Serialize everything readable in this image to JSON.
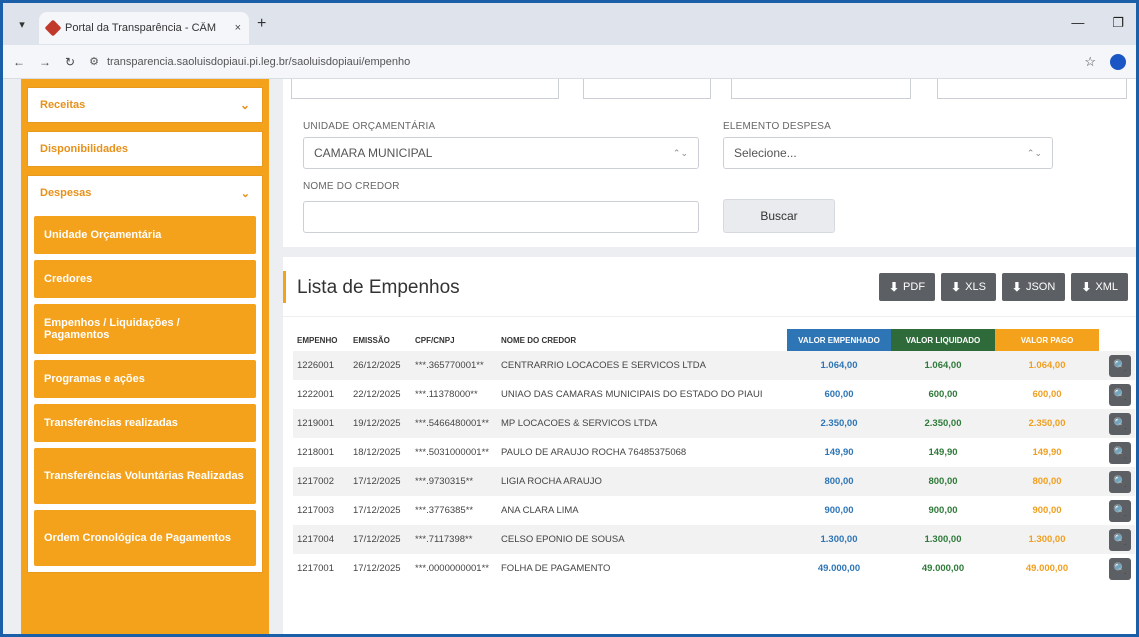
{
  "browser": {
    "tab_title": "Portal da Transparência - CÂM",
    "tab_close": "×",
    "new_tab": "+",
    "menu_glyph": "▾",
    "url": "transparencia.saoluisdopiaui.pi.leg.br/saoluisdopiaui/empenho",
    "url_prefix": "⚙",
    "back": "←",
    "forward": "→",
    "reload": "↻",
    "star": "☆",
    "minimize": "—",
    "restore": "❐"
  },
  "sidebar": {
    "receitas": "Receitas",
    "disponibilidades": "Disponibilidades",
    "despesas": "Despesas",
    "sub_items": [
      "Unidade Orçamentária",
      "Credores",
      "Empenhos / Liquidações / Pagamentos",
      "Programas e ações",
      "Transferências realizadas",
      "Transferências Voluntárias Realizadas",
      "Ordem Cronológica de Pagamentos"
    ],
    "chevron": "⌄"
  },
  "filters": {
    "unidade_label": "UNIDADE ORÇAMENTÁRIA",
    "unidade_value": "CAMARA MUNICIPAL",
    "elemento_label": "ELEMENTO DESPESA",
    "elemento_value": "Selecione...",
    "credor_label": "NOME DO CREDOR",
    "credor_value": "",
    "buscar_label": "Buscar",
    "caret": "⌃⌄"
  },
  "list": {
    "title": "Lista de Empenhos",
    "export_buttons": [
      "PDF",
      "XLS",
      "JSON",
      "XML"
    ],
    "download_glyph": "⬇",
    "search_glyph": "🔍",
    "columns": [
      "EMPENHO",
      "EMISSÃO",
      "CPF/CNPJ",
      "NOME DO CREDOR",
      "VALOR EMPENHADO",
      "VALOR LIQUIDADO",
      "VALOR PAGO"
    ],
    "rows": [
      {
        "empenho": "1226001",
        "emissao": "26/12/2025",
        "cpf": "***.365770001**",
        "credor": "CENTRARRIO LOCACOES E SERVICOS LTDA",
        "empenhado": "1.064,00",
        "liquidado": "1.064,00",
        "pago": "1.064,00"
      },
      {
        "empenho": "1222001",
        "emissao": "22/12/2025",
        "cpf": "***.11378000**",
        "credor": "UNIAO DAS CAMARAS MUNICIPAIS DO ESTADO DO PIAUI",
        "empenhado": "600,00",
        "liquidado": "600,00",
        "pago": "600,00"
      },
      {
        "empenho": "1219001",
        "emissao": "19/12/2025",
        "cpf": "***.5466480001**",
        "credor": "MP LOCACOES & SERVICOS LTDA",
        "empenhado": "2.350,00",
        "liquidado": "2.350,00",
        "pago": "2.350,00"
      },
      {
        "empenho": "1218001",
        "emissao": "18/12/2025",
        "cpf": "***.5031000001**",
        "credor": "PAULO DE ARAUJO ROCHA 76485375068",
        "empenhado": "149,90",
        "liquidado": "149,90",
        "pago": "149,90"
      },
      {
        "empenho": "1217002",
        "emissao": "17/12/2025",
        "cpf": "***.9730315**",
        "credor": "LIGIA ROCHA ARAUJO",
        "empenhado": "800,00",
        "liquidado": "800,00",
        "pago": "800,00"
      },
      {
        "empenho": "1217003",
        "emissao": "17/12/2025",
        "cpf": "***.3776385**",
        "credor": "ANA CLARA LIMA",
        "empenhado": "900,00",
        "liquidado": "900,00",
        "pago": "900,00"
      },
      {
        "empenho": "1217004",
        "emissao": "17/12/2025",
        "cpf": "***.7117398**",
        "credor": "CELSO EPONIO DE SOUSA",
        "empenhado": "1.300,00",
        "liquidado": "1.300,00",
        "pago": "1.300,00"
      },
      {
        "empenho": "1217001",
        "emissao": "17/12/2025",
        "cpf": "***.0000000001**",
        "credor": "FOLHA DE PAGAMENTO",
        "empenhado": "49.000,00",
        "liquidado": "49.000,00",
        "pago": "49.000,00"
      }
    ]
  }
}
